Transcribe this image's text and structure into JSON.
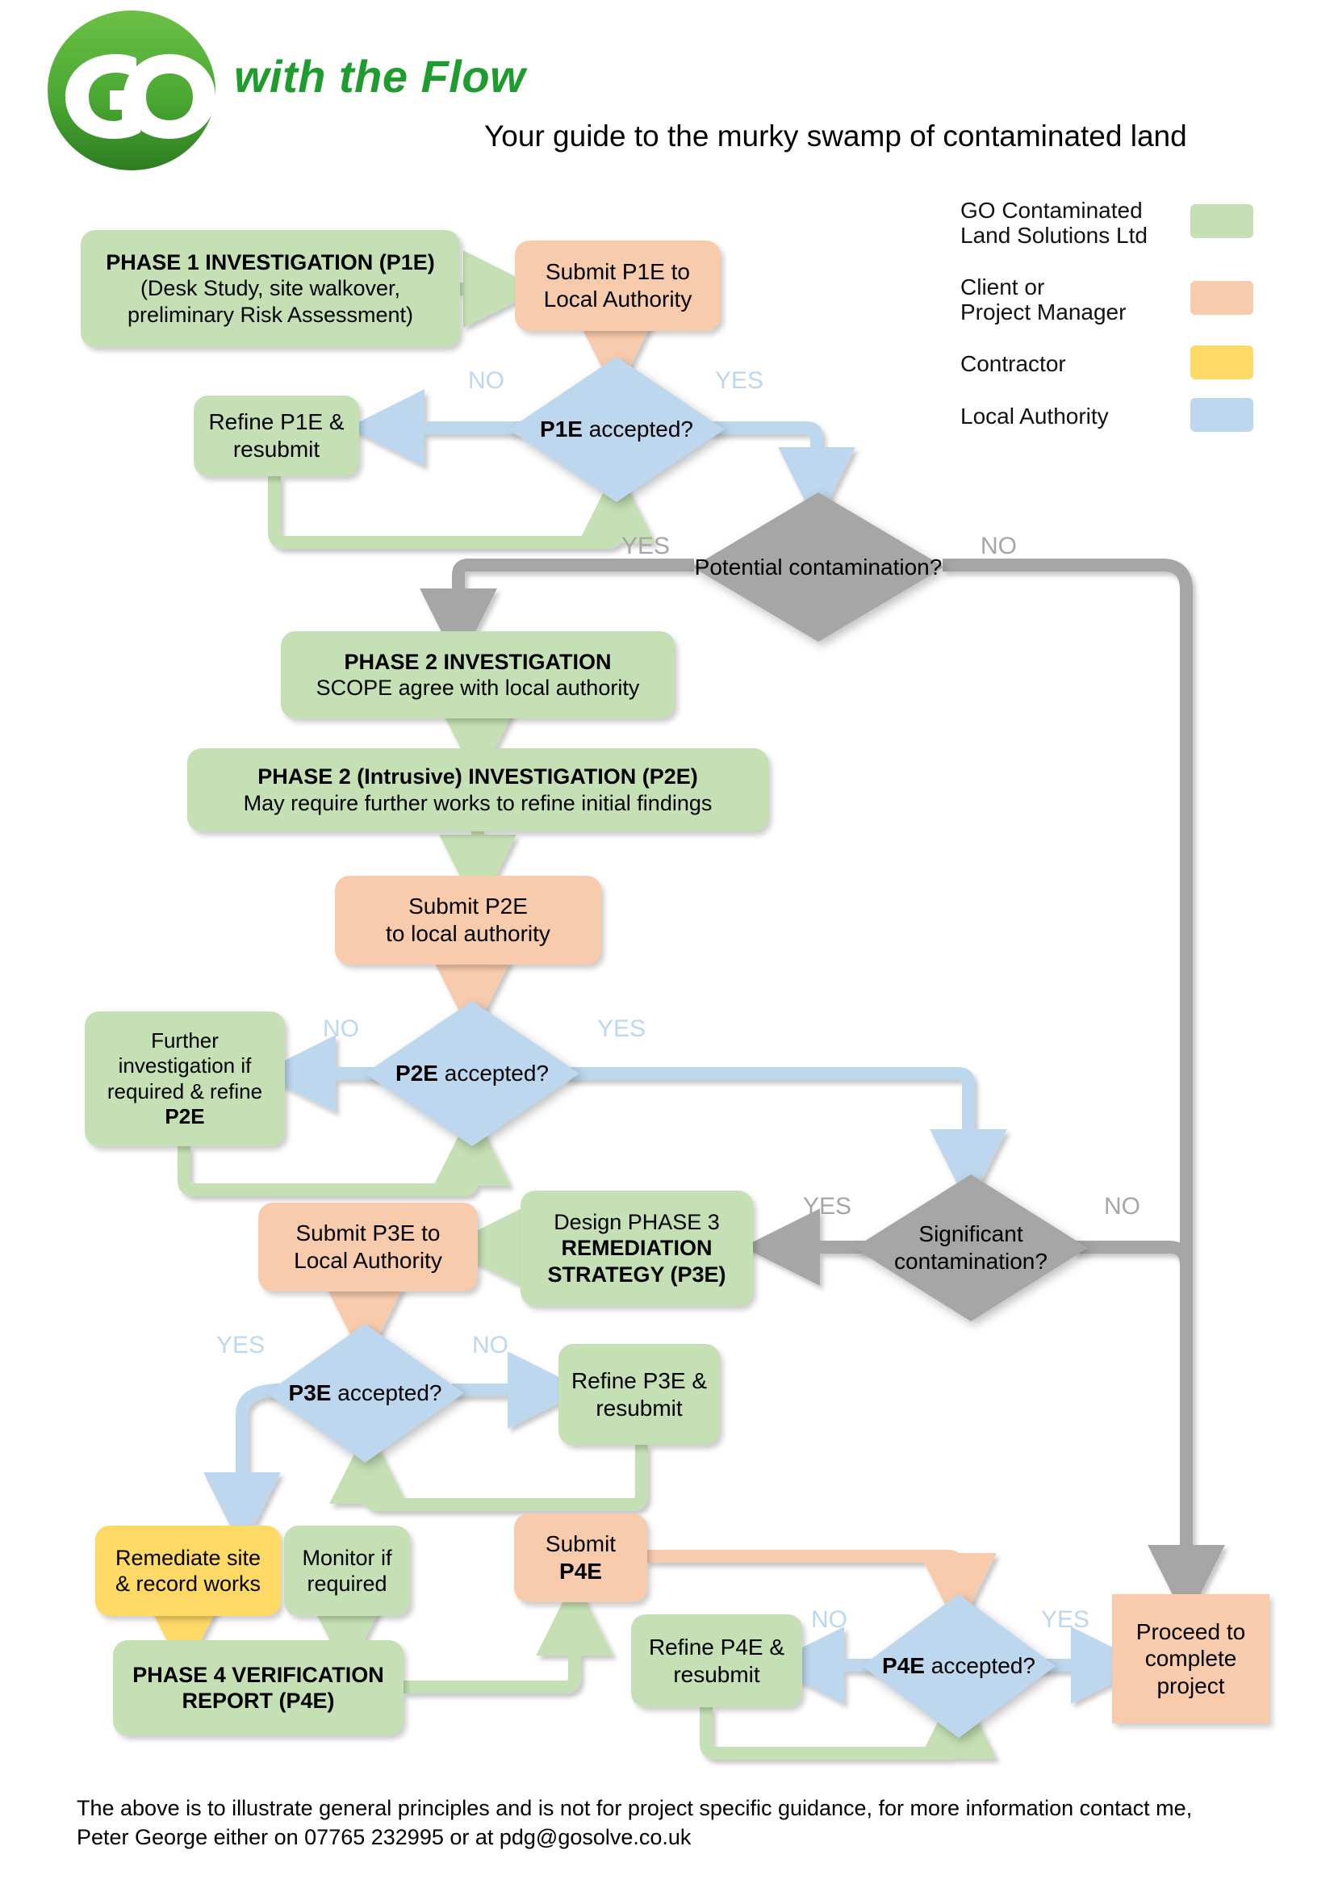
{
  "header": {
    "logo_text": "GO",
    "brand_title": "with the Flow",
    "subtitle": "Your guide to the murky swamp of contaminated land"
  },
  "legend": {
    "items": [
      {
        "label": "GO Contaminated\nLand Solutions Ltd",
        "color": "#c5e0b4",
        "name": "legend-go-contaminated-land"
      },
      {
        "label": "Client or\nProject Manager",
        "color": "#f8cbad",
        "name": "legend-client-project-manager"
      },
      {
        "label": "Contractor",
        "color": "#ffd966",
        "name": "legend-contractor"
      },
      {
        "label": "Local Authority",
        "color": "#bdd7ee",
        "name": "legend-local-authority"
      }
    ]
  },
  "nodes": {
    "phase1": {
      "line1": "PHASE 1 INVESTIGATION (P1E)",
      "line2": "(Desk Study, site walkover,",
      "line3": "preliminary Risk Assessment)"
    },
    "submit_p1e": {
      "line1": "Submit P1E to",
      "line2": "Local Authority"
    },
    "refine_p1e": {
      "line1": "Refine P1E &",
      "line2": "resubmit"
    },
    "p1e_accepted": {
      "line1": "P1E",
      "line2": "accepted?"
    },
    "potential_contamination": {
      "line1": "Potential",
      "line2": "contamination?"
    },
    "phase2_scope": {
      "line1": "PHASE 2 INVESTIGATION",
      "line2": "SCOPE agree with local authority"
    },
    "phase2_intrusive": {
      "line1": "PHASE 2 (Intrusive) INVESTIGATION (P2E)",
      "line2": "May require further works to refine initial findings"
    },
    "submit_p2e": {
      "line1": "Submit P2E",
      "line2": "to local authority"
    },
    "further_investigation": {
      "line1": "Further",
      "line2": "investigation if",
      "line3": "required & refine",
      "line4": "P2E"
    },
    "p2e_accepted": {
      "line1": "P2E",
      "line2": "accepted?"
    },
    "significant_contamination": {
      "line1": "Significant",
      "line2": "contamination?"
    },
    "design_phase3": {
      "line1": "Design PHASE 3",
      "line2": "REMEDIATION",
      "line3": "STRATEGY (P3E)"
    },
    "submit_p3e": {
      "line1": "Submit P3E to",
      "line2": "Local Authority"
    },
    "p3e_accepted": {
      "line1": "P3E",
      "line2": "accepted?"
    },
    "refine_p3e": {
      "line1": "Refine P3E &",
      "line2": "resubmit"
    },
    "remediate_site": {
      "line1": "Remediate site",
      "line2": "& record works"
    },
    "monitor_if_required": {
      "line1": "Monitor if",
      "line2": "required"
    },
    "phase4_report": {
      "line1": "PHASE 4 VERIFICATION",
      "line2": "REPORT (P4E)"
    },
    "submit_p4e": {
      "line1": "Submit",
      "line2": "P4E"
    },
    "refine_p4e": {
      "line1": "Refine P4E &",
      "line2": "resubmit"
    },
    "p4e_accepted": {
      "line1": "P4E",
      "line2": "accepted?"
    },
    "proceed_complete": {
      "line1": "Proceed to",
      "line2": "complete",
      "line3": "project"
    }
  },
  "edge_labels": {
    "p1e_no": "NO",
    "p1e_yes": "YES",
    "potential_yes": "YES",
    "potential_no": "NO",
    "p2e_no": "NO",
    "p2e_yes": "YES",
    "significant_yes": "YES",
    "significant_no": "NO",
    "p3e_yes": "YES",
    "p3e_no": "NO",
    "p4e_no": "NO",
    "p4e_yes": "YES"
  },
  "footer": {
    "text": "The above is to illustrate general principles and is not for project specific guidance, for more information contact me,\nPeter George either on 07765 232995 or at pdg@gosolve.co.uk"
  },
  "colors": {
    "green": "#c5e0b4",
    "peach": "#f8cbad",
    "yellow": "#ffd966",
    "blue": "#bdd7ee",
    "gray": "#a6a6a6",
    "brand_green": "#1f9c2e"
  }
}
